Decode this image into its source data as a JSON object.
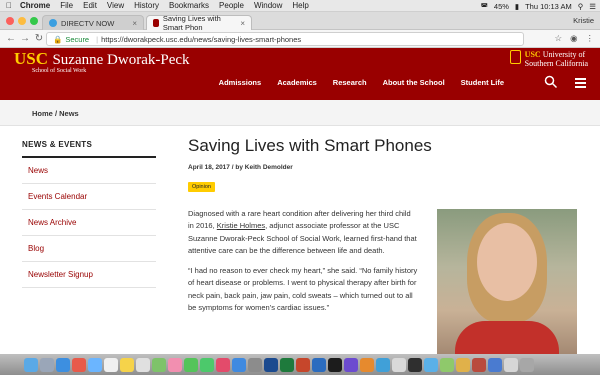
{
  "mac_menubar": {
    "app": "Chrome",
    "items": [
      "File",
      "Edit",
      "View",
      "History",
      "Bookmarks",
      "People",
      "Window",
      "Help"
    ],
    "status": {
      "battery": "45%",
      "clock": "Thu 10:13 AM"
    }
  },
  "browser": {
    "tabs": [
      {
        "label": "DIRECTV NOW",
        "active": false
      },
      {
        "label": "Saving Lives with Smart Phon",
        "active": true
      }
    ],
    "user": "Kristie",
    "secure_label": "Secure",
    "url": "https://dworakpeck.usc.edu/news/saving-lives-smart-phones"
  },
  "site": {
    "logo_usc": "USC",
    "logo_name": "Suzanne Dworak-Peck",
    "logo_sub": "School of Social Work",
    "university": {
      "usc": "USC",
      "line1": "University of",
      "line2": "Southern California"
    },
    "nav": [
      "Admissions",
      "Academics",
      "Research",
      "About the School",
      "Student Life"
    ]
  },
  "breadcrumb": {
    "home": "Home",
    "sep": "/",
    "current": "News"
  },
  "sidebar": {
    "title": "NEWS & EVENTS",
    "links": [
      "News",
      "Events Calendar",
      "News Archive",
      "Blog",
      "Newsletter Signup"
    ]
  },
  "article": {
    "title": "Saving Lives with Smart Phones",
    "date": "April 18, 2017",
    "by": "by",
    "author": "Keith Demolder",
    "tag": "Opinion",
    "p1_pre": "Diagnosed with a rare heart condition after delivering her third child in 2016, ",
    "p1_link": "Kristie Holmes",
    "p1_post": ", adjunct associate professor at the USC Suzanne Dworak-Peck School of Social Work, learned first-hand that attentive care can be the difference between life and death.",
    "p2": "“I had no reason to ever check my heart,” she said. “No family history of heart disease or problems. I went to physical therapy after birth for neck pain, back pain, jaw pain, cold sweats – which turned out to all be symptoms for women’s cardiac issues.”"
  },
  "colors": {
    "usc_cardinal": "#990000",
    "usc_gold": "#FFCC00"
  }
}
